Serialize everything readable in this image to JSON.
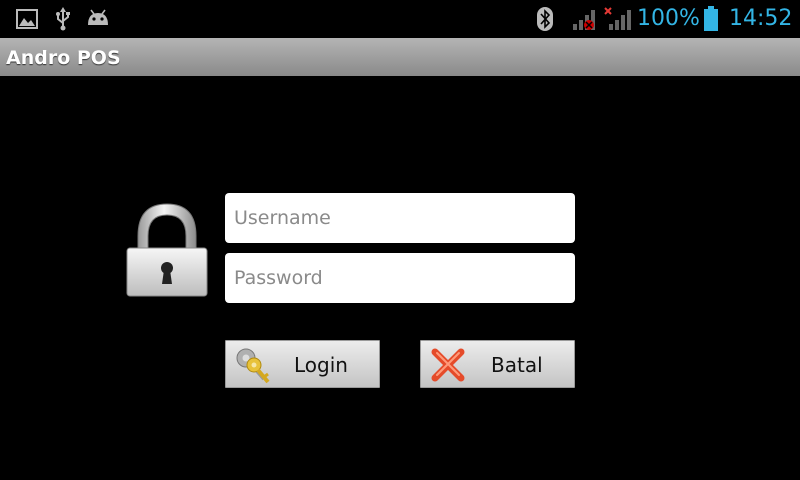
{
  "status_bar": {
    "left_icons": [
      "gallery-icon",
      "usb-icon",
      "android-debug-icon"
    ],
    "right_icons": [
      "bluetooth-icon",
      "signal-icon",
      "signal-no-service-icon",
      "battery-icon"
    ],
    "battery_percent": "100%",
    "time": "14:52",
    "accent_color": "#33b5e5"
  },
  "title_bar": {
    "title": "Andro POS"
  },
  "login_form": {
    "username_placeholder": "Username",
    "password_placeholder": "Password",
    "login_label": "Login",
    "cancel_label": "Batal"
  }
}
